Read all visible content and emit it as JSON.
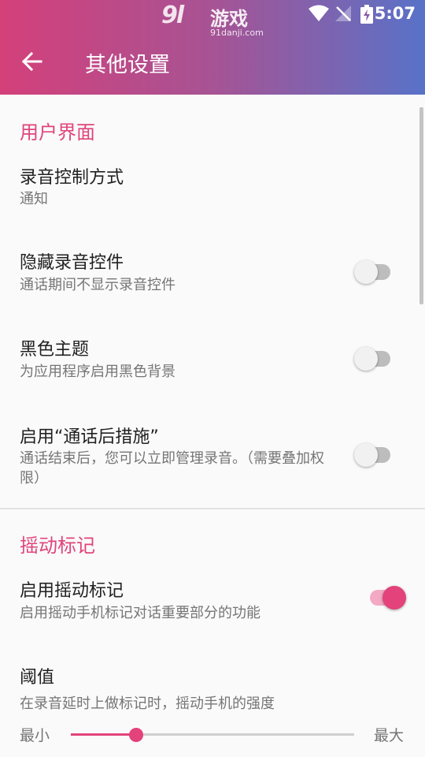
{
  "status_bar": {
    "time": "5:07",
    "watermark_logo": "9l",
    "watermark_text": "游戏",
    "watermark_url": "91danji.com"
  },
  "toolbar": {
    "title": "其他设置"
  },
  "sections": {
    "ui": {
      "title": "用户界面"
    },
    "shake": {
      "title": "摇动标记"
    }
  },
  "settings": {
    "recording_control": {
      "title": "录音控制方式",
      "summary": "通知"
    },
    "hide_controls": {
      "title": "隐藏录音控件",
      "summary": "通话期间不显示录音控件",
      "enabled": false
    },
    "dark_theme": {
      "title": "黑色主题",
      "summary": "为应用程序启用黑色背景",
      "enabled": false
    },
    "after_call": {
      "title": "启用“通话后措施”",
      "summary": "通话结束后，您可以立即管理录音。（需要叠加权限）",
      "enabled": false
    },
    "shake_mark": {
      "title": "启用摇动标记",
      "summary": "启用摇动手机标记对话重要部分的功能",
      "enabled": true
    },
    "threshold": {
      "title": "阈值",
      "summary": "在录音延时上做标记时，摇动手机的强度",
      "min_label": "最小",
      "max_label": "最大",
      "value_fraction": 0.23
    }
  },
  "colors": {
    "accent": "#e3427a",
    "header_start": "#d4407a",
    "header_end": "#5872c8"
  },
  "icons": {
    "back": "arrow-back-icon",
    "wifi": "wifi-icon",
    "signal": "no-signal-icon",
    "battery": "battery-charging-icon"
  }
}
